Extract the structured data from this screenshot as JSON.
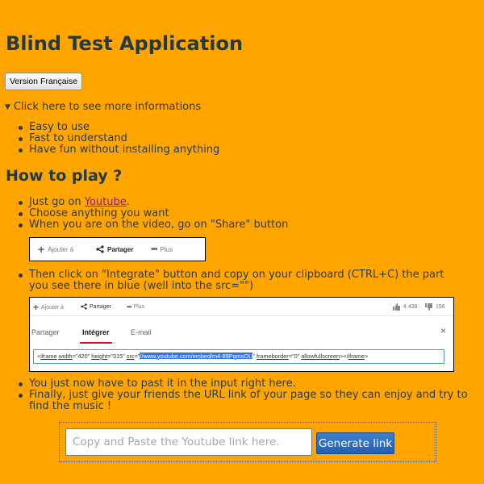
{
  "page": {
    "title": "Blind Test Application",
    "lang_button": "Version Française",
    "details_label": "Click here to see more informations",
    "features": [
      "Easy to use",
      "Fast to understand",
      "Have fun without installing anything"
    ],
    "how_to_title": "How to play ?",
    "steps": {
      "step1_prefix": "Just go on ",
      "step1_link": "Youtube",
      "step1_suffix": ".",
      "step2": "Choose anything you want",
      "step3": "When you are on the video, go on \"Share\" button",
      "step4": "Then click on \"Integrate\" button and copy on your clipboard (CTRL+C) the part you see there in blue (well into the src=\"\")",
      "step5": "You just now have to past it in the input right here.",
      "step6": "Finally, just give your friends the URL link of your page so they can enjoy and try to find the music !"
    },
    "share_bar": {
      "add_label": "Ajouter à",
      "share_label": "Partager",
      "more_label": "Plus"
    },
    "embed_panel": {
      "add_label": "Ajouter à",
      "share_label": "Partager",
      "more_label": "Plus",
      "likes": "4 438",
      "dislikes": "156",
      "tabs": [
        "Partager",
        "Intégrer",
        "E-mail"
      ],
      "code": {
        "p1": "<",
        "p2": "iframe",
        "p3": " ",
        "p4": "width",
        "p5": "=\"420\" ",
        "p6": "height",
        "p7": "=\"315\" ",
        "p8": "src",
        "p9": "=\"",
        "p10": "//www.youtube.com/embed/m4-89PqmsOU",
        "p11": "\" ",
        "p12": "frameborder",
        "p13": "=\"0\" ",
        "p14": "allowfullscreen",
        "p15": "></",
        "p16": "iframe",
        "p17": ">"
      }
    },
    "input_placeholder": "Copy and Paste the Youtube link here.",
    "generate_button": "Generate link"
  }
}
